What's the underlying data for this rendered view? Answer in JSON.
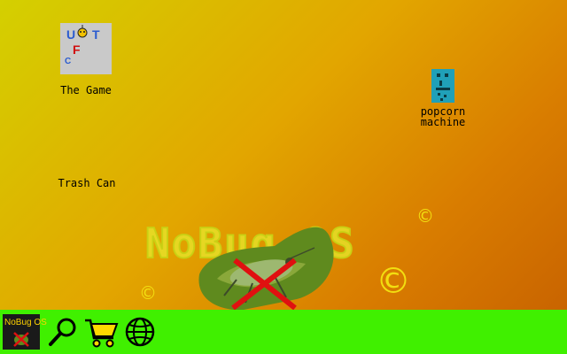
{
  "desktop": {
    "icons": [
      {
        "label": "The Game",
        "icon": "game-icon",
        "thumb_letters": [
          "U",
          "T",
          "F",
          "C"
        ]
      },
      {
        "label": "Trash Can",
        "icon": "trash-can-icon"
      },
      {
        "label": "popcorn\nmachine",
        "icon": "popcorn-machine-icon"
      }
    ],
    "wallpaper": {
      "logo_text": "NoBug OS",
      "copyright_symbol": "©"
    }
  },
  "taskbar": {
    "start_label": "NoBug OS",
    "buttons": [
      {
        "icon": "start-logo-icon"
      },
      {
        "icon": "search-icon"
      },
      {
        "icon": "shopping-cart-icon"
      },
      {
        "icon": "globe-icon"
      }
    ]
  },
  "colors": {
    "taskbar": "#40f000",
    "desktop_top_left": "#d4d000",
    "desktop_bottom_right": "#c96400",
    "logo_text": "#e6e128",
    "copyright": "#f2de10",
    "cross": "#e01010"
  }
}
